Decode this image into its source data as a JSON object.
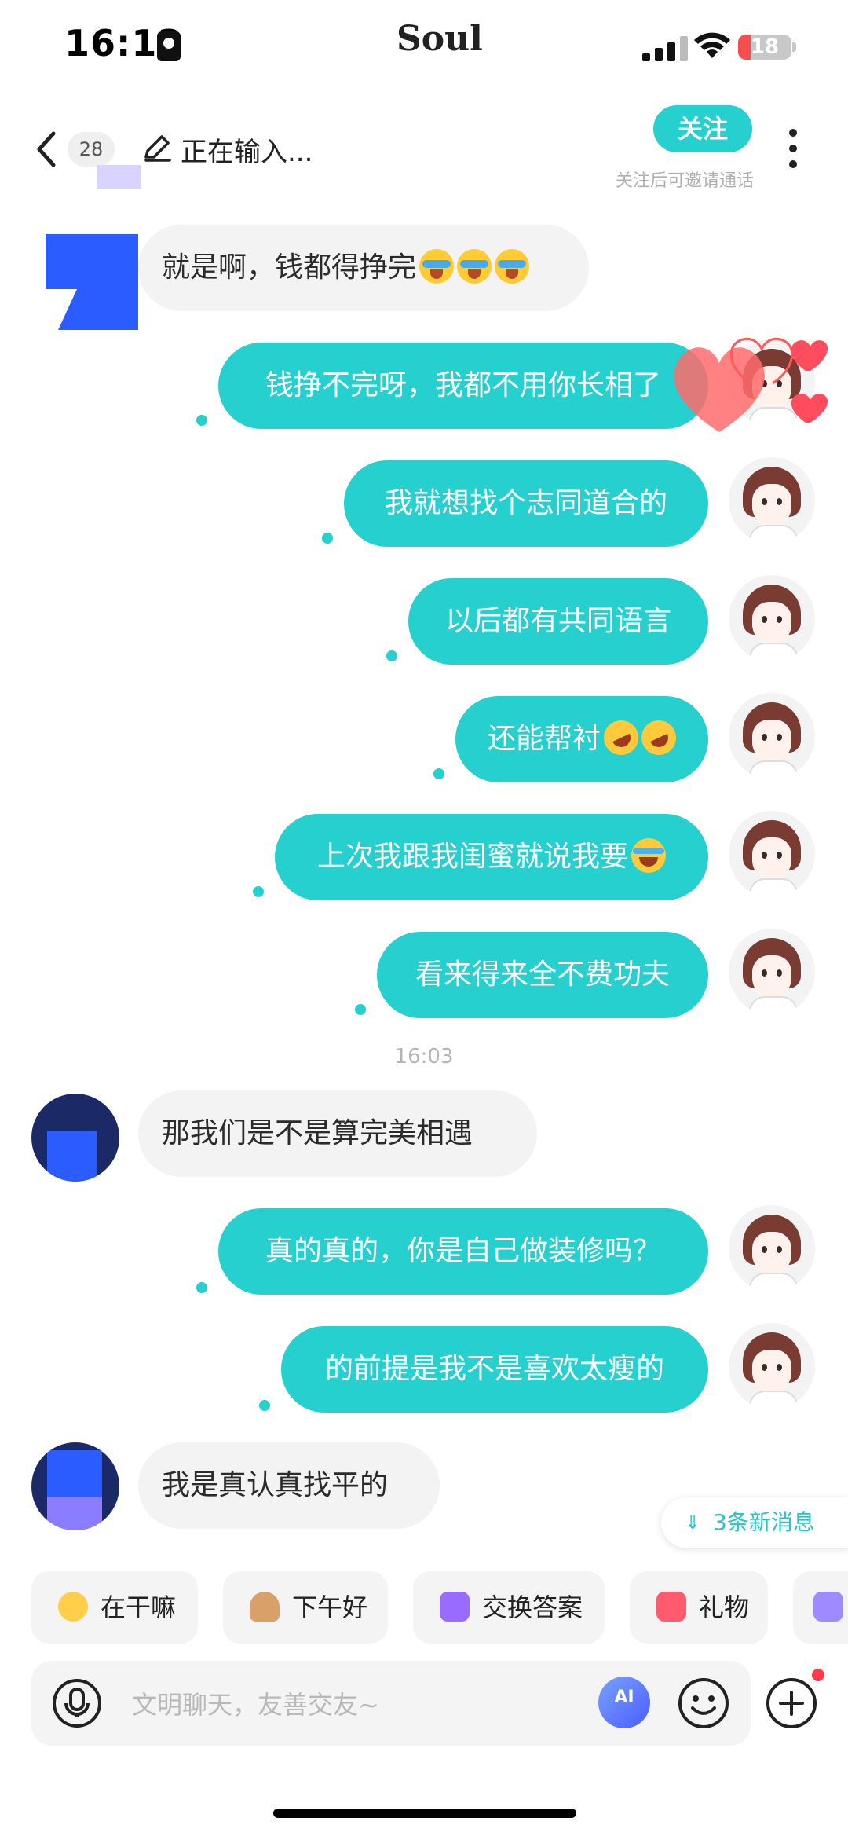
{
  "status_bar": {
    "time": "16:13",
    "brand": "Soul",
    "battery": "18"
  },
  "header": {
    "unread_count": "28",
    "status": "正在输入...",
    "follow_label": "关注",
    "follow_hint": "关注后可邀请通话"
  },
  "messages": [
    {
      "side": "other",
      "text": "就是啊，钱都得挣完",
      "emoji": [
        "cry",
        "cry",
        "cry"
      ]
    },
    {
      "side": "me",
      "text": "钱挣不完呀，我都不用你长相了"
    },
    {
      "side": "me",
      "text": "我就想找个志同道合的"
    },
    {
      "side": "me",
      "text": "以后都有共同语言"
    },
    {
      "side": "me",
      "text": "还能帮衬",
      "emoji": [
        "rofl",
        "rofl"
      ]
    },
    {
      "side": "me",
      "text": "上次我跟我闺蜜就说我要",
      "emoji": [
        "joy"
      ]
    },
    {
      "side": "me",
      "text": "看来得来全不费功夫"
    },
    {
      "side": "time",
      "text": "16:03"
    },
    {
      "side": "other",
      "text": "那我们是不是算完美相遇"
    },
    {
      "side": "me",
      "text": "真的真的，你是自己做装修吗？"
    },
    {
      "side": "me",
      "text": "的前提是我不是喜欢太瘦的"
    },
    {
      "side": "other",
      "text": "我是真认真找平的"
    }
  ],
  "new_messages": {
    "label": "3条新消息"
  },
  "quick_replies": [
    {
      "label": "在干嘛",
      "icon": "thinking-face-icon"
    },
    {
      "label": "下午好",
      "icon": "coffee-icon"
    },
    {
      "label": "交换答案",
      "icon": "swap-icon"
    },
    {
      "label": "礼物",
      "icon": "gift-icon"
    }
  ],
  "input": {
    "placeholder": "文明聊天，友善交友~"
  },
  "colors": {
    "accent": "#25d0cf",
    "other_bubble": "#f3f3f3"
  }
}
